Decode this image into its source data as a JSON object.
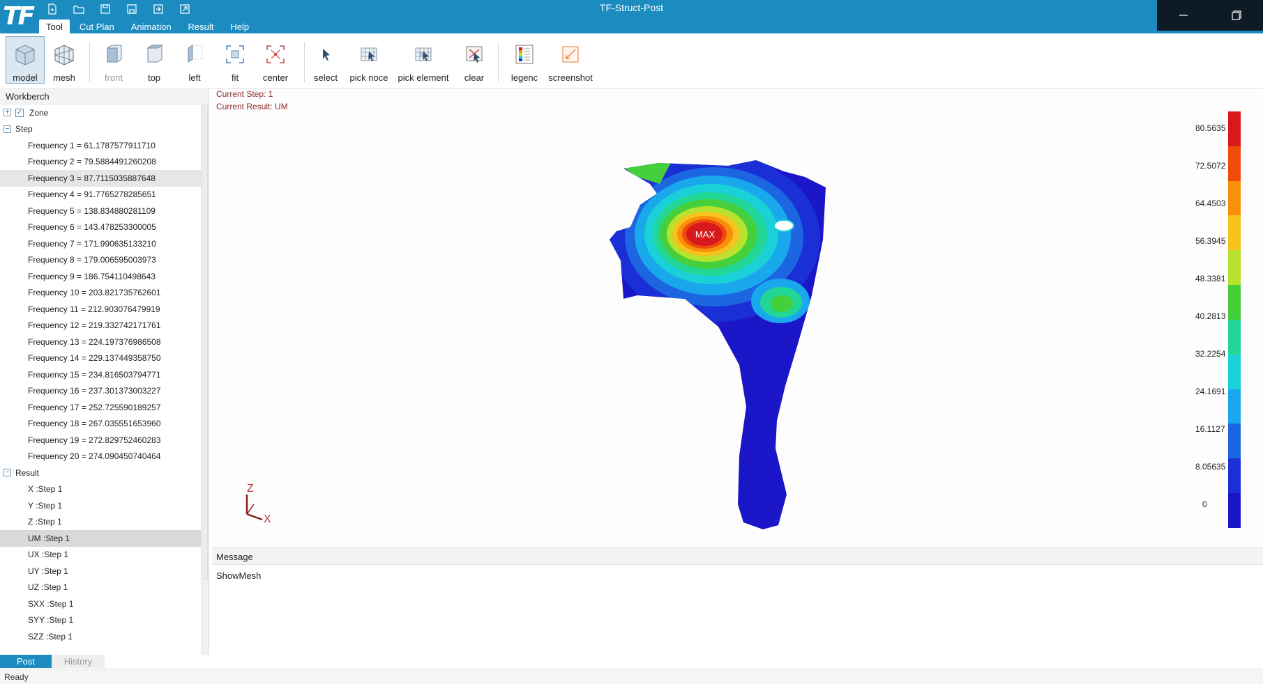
{
  "app": {
    "logo": "TF",
    "title": "TF-Struct-Post"
  },
  "menu": {
    "tabs": [
      "Tool",
      "Cut Plan",
      "Animation",
      "Result",
      "Help"
    ]
  },
  "ribbon": {
    "model": "model",
    "mesh": "mesh",
    "front": "front",
    "top": "top",
    "left": "left",
    "fit": "fit",
    "center": "center",
    "select": "select",
    "pick_node": "pick noce",
    "pick_element": "pick element",
    "clear": "clear",
    "legend": "legenc",
    "screenshot": "screenshot"
  },
  "workbench": {
    "header": "Workberch",
    "zone": "Zone",
    "step": "Step",
    "frequencies": [
      "Frequency  1 = 61.1787577911710",
      "Frequency  2 = 79.5884491260208",
      "Frequency  3 = 87.7115035887648",
      "Frequency  4 = 91.7765278285651",
      "Frequency  5 = 138.834880281109",
      "Frequency  6 = 143.478253300005",
      "Frequency  7 = 171.990635133210",
      "Frequency  8 = 179.006595003973",
      "Frequency  9 = 186.754110498643",
      "Frequency  10 = 203.821735762601",
      "Frequency  11 = 212.903076479919",
      "Frequency  12 = 219.332742171761",
      "Frequency  13 = 224.197376986508",
      "Frequency  14 = 229.137449358750",
      "Frequency  15 = 234.816503794771",
      "Frequency  16 = 237.301373003227",
      "Frequency  17 = 252.725590189257",
      "Frequency  18 = 267.035551653960",
      "Frequency  19 = 272.829752460283",
      "Frequency  20 = 274.090450740464"
    ],
    "result": "Result",
    "results": [
      "X :Step 1",
      "Y :Step 1",
      "Z :Step 1",
      "UM :Step 1",
      "UX :Step 1",
      "UY :Step 1",
      "UZ :Step 1",
      "SXX :Step 1",
      "SYY :Step 1",
      "SZZ :Step 1"
    ]
  },
  "viewport": {
    "current_step": "Current Step: 1",
    "current_result": "Current Result: UM",
    "max_label": "MAX",
    "axis_z": "Z",
    "axis_x": "X",
    "legend_labels": [
      "80.5635",
      "72.5072",
      "64.4503",
      "56.3945",
      "48.3381",
      "40.2813",
      "32.2254",
      "24.1691",
      "16.1127",
      "8.05635",
      "0"
    ],
    "legend_colors": [
      "#d7191c",
      "#f04a0c",
      "#f9900a",
      "#f7c21e",
      "#b8e22d",
      "#45cf3a",
      "#22d796",
      "#1ad1d8",
      "#1aa8ec",
      "#1c66e2",
      "#1a2fd6",
      "#1b17c9"
    ]
  },
  "message": {
    "header": "Message",
    "body": "ShowMesh"
  },
  "bottom_tabs": [
    "Post",
    "History"
  ],
  "status": "Ready"
}
